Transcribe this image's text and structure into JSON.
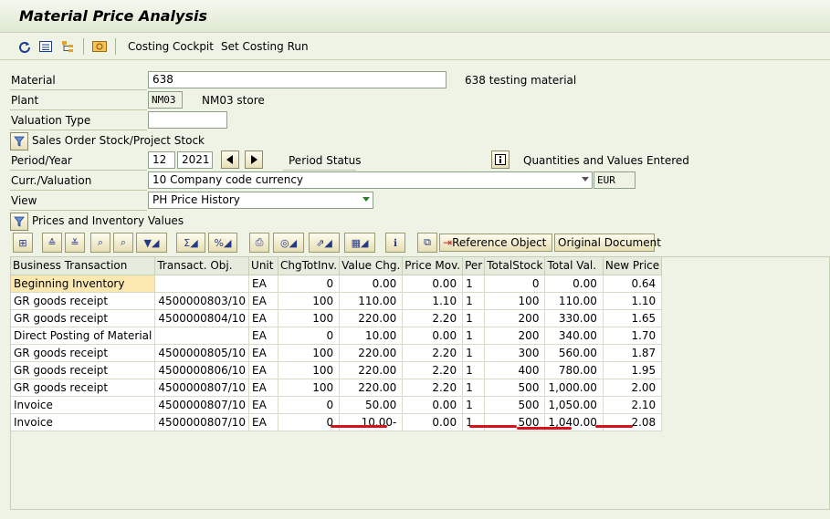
{
  "title": "Material Price Analysis",
  "appbar": {
    "costing_cockpit": "Costing Cockpit",
    "set_costing_run": "Set Costing Run"
  },
  "form": {
    "material_label": "Material",
    "material_value": "638",
    "material_desc": "638 testing material",
    "plant_label": "Plant",
    "plant_value": "NM03",
    "plant_desc": "NM03 store",
    "valuation_type_label": "Valuation Type",
    "valuation_type_value": "",
    "sales_order_stock": "Sales Order Stock/Project Stock",
    "period_year_label": "Period/Year",
    "period_value": "12",
    "year_value": "2021",
    "period_status_label": "Period Status",
    "period_status_value": "Quantities and Values Entered",
    "curr_valuation_label": "Curr./Valuation",
    "curr_valuation_value": "10 Company code currency",
    "currency": "EUR",
    "view_label": "View",
    "view_value": "PH Price History",
    "prices_inventory": "Prices and Inventory Values"
  },
  "toolbar": {
    "reference_object": "Reference Object",
    "original_document": "Original Document"
  },
  "table": {
    "columns": [
      "Business Transaction",
      "Transact. Obj.",
      "Unit",
      "ChgTotInv.",
      "Value Chg.",
      "Price Mov.",
      "Per",
      "TotalStock",
      "Total Val.",
      "New Price"
    ],
    "rows": [
      [
        "Beginning Inventory",
        "",
        "EA",
        "0",
        "0.00",
        "0.00",
        "1",
        "0",
        "0.00",
        "0.64"
      ],
      [
        "GR goods receipt",
        "4500000803/10",
        "EA",
        "100",
        "110.00",
        "1.10",
        "1",
        "100",
        "110.00",
        "1.10"
      ],
      [
        "GR goods receipt",
        "4500000804/10",
        "EA",
        "100",
        "220.00",
        "2.20",
        "1",
        "200",
        "330.00",
        "1.65"
      ],
      [
        "Direct Posting of Material",
        "",
        "EA",
        "0",
        "10.00",
        "0.00",
        "1",
        "200",
        "340.00",
        "1.70"
      ],
      [
        "GR goods receipt",
        "4500000805/10",
        "EA",
        "100",
        "220.00",
        "2.20",
        "1",
        "300",
        "560.00",
        "1.87"
      ],
      [
        "GR goods receipt",
        "4500000806/10",
        "EA",
        "100",
        "220.00",
        "2.20",
        "1",
        "400",
        "780.00",
        "1.95"
      ],
      [
        "GR goods receipt",
        "4500000807/10",
        "EA",
        "100",
        "220.00",
        "2.20",
        "1",
        "500",
        "1,000.00",
        "2.00"
      ],
      [
        "Invoice",
        "4500000807/10",
        "EA",
        "0",
        "50.00",
        "0.00",
        "1",
        "500",
        "1,050.00",
        "2.10"
      ],
      [
        "Invoice",
        "4500000807/10",
        "EA",
        "0",
        "10.00-",
        "0.00",
        "1",
        "500",
        "1,040.00",
        "2.08"
      ]
    ]
  },
  "colors": {
    "annotation_underline": "#d8111a",
    "highlight_cell": "#fbe8b0",
    "background": "#eef3e6"
  },
  "icons": [
    "refresh-icon",
    "list-icon",
    "hierarchy-icon",
    "costing-icon",
    "info-icon",
    "filter-icon",
    "sum-icon",
    "print-icon",
    "export-icon"
  ]
}
